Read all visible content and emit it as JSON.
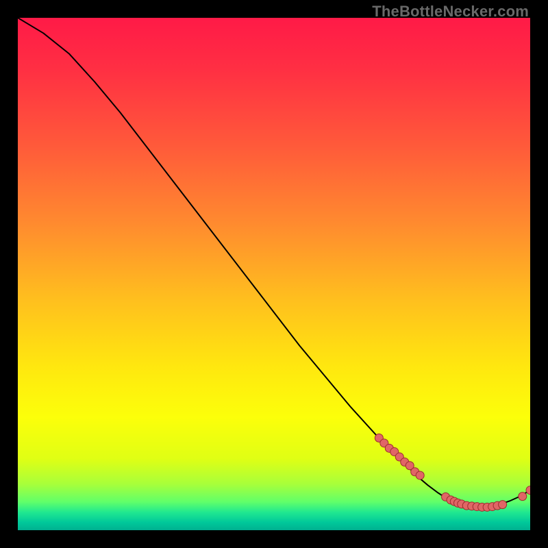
{
  "watermark": "TheBottleNecker.com",
  "chart_data": {
    "type": "line",
    "title": "",
    "xlabel": "",
    "ylabel": "",
    "xlim": [
      0,
      100
    ],
    "ylim": [
      0,
      100
    ],
    "grid": false,
    "series": [
      {
        "name": "curve",
        "x": [
          0,
          5,
          10,
          15,
          20,
          25,
          30,
          35,
          40,
          45,
          50,
          55,
          60,
          65,
          70,
          72,
          74,
          76,
          78,
          80,
          82,
          84,
          86,
          88,
          90,
          92,
          94,
          96,
          98,
          100
        ],
        "y": [
          100,
          97,
          93,
          87.5,
          81.5,
          75,
          68.5,
          62,
          55.5,
          49,
          42.5,
          36,
          30,
          24,
          18.5,
          16.5,
          14.5,
          12.5,
          10.5,
          8.8,
          7.3,
          6.0,
          5.2,
          4.7,
          4.5,
          4.6,
          5.0,
          5.7,
          6.6,
          7.8
        ]
      }
    ],
    "markers": {
      "name": "points",
      "x": [
        70.5,
        71.5,
        72.5,
        73.5,
        74.5,
        75.5,
        76.5,
        77.5,
        78.5,
        83.5,
        84.5,
        85.2,
        85.9,
        86.6,
        87.6,
        88.6,
        89.6,
        90.6,
        91.6,
        92.6,
        93.6,
        94.6,
        98.5,
        100.0
      ],
      "y": [
        18.0,
        17.0,
        16.0,
        15.3,
        14.3,
        13.3,
        12.6,
        11.4,
        10.7,
        6.5,
        5.9,
        5.6,
        5.3,
        5.1,
        4.8,
        4.7,
        4.6,
        4.5,
        4.5,
        4.6,
        4.8,
        5.0,
        6.6,
        7.8
      ]
    },
    "background_gradient": {
      "stops": [
        {
          "offset": 0.0,
          "color": "#ff1a47"
        },
        {
          "offset": 0.1,
          "color": "#ff2f43"
        },
        {
          "offset": 0.25,
          "color": "#ff5a3a"
        },
        {
          "offset": 0.4,
          "color": "#ff8a2f"
        },
        {
          "offset": 0.55,
          "color": "#ffbf1e"
        },
        {
          "offset": 0.68,
          "color": "#ffe70f"
        },
        {
          "offset": 0.78,
          "color": "#fcff0a"
        },
        {
          "offset": 0.86,
          "color": "#e0ff14"
        },
        {
          "offset": 0.91,
          "color": "#a8ff3a"
        },
        {
          "offset": 0.945,
          "color": "#60ff6a"
        },
        {
          "offset": 0.965,
          "color": "#20e890"
        },
        {
          "offset": 0.985,
          "color": "#00c89a"
        },
        {
          "offset": 1.0,
          "color": "#00b090"
        }
      ]
    },
    "marker_style": {
      "fill": "#e06666",
      "stroke": "#9c2d2d",
      "r": 6
    },
    "line_style": {
      "stroke": "#000000",
      "width": 2
    }
  }
}
